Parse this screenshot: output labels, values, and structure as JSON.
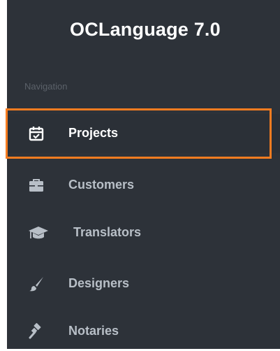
{
  "app": {
    "title": "OCLanguage 7.0"
  },
  "sidebar": {
    "section_label": "Navigation",
    "items": [
      {
        "label": "Projects",
        "icon": "calendar-check-icon",
        "active": true
      },
      {
        "label": "Customers",
        "icon": "briefcase-icon",
        "active": false
      },
      {
        "label": "Translators",
        "icon": "graduation-cap-icon",
        "active": false
      },
      {
        "label": "Designers",
        "icon": "paint-brush-icon",
        "active": false
      },
      {
        "label": "Notaries",
        "icon": "gavel-icon",
        "active": false
      }
    ]
  },
  "colors": {
    "sidebar_bg": "#2d3239",
    "highlight": "#f57c20",
    "active_text": "#ffffff",
    "inactive_text": "#b8bfc7",
    "section_label": "#5b6169"
  }
}
